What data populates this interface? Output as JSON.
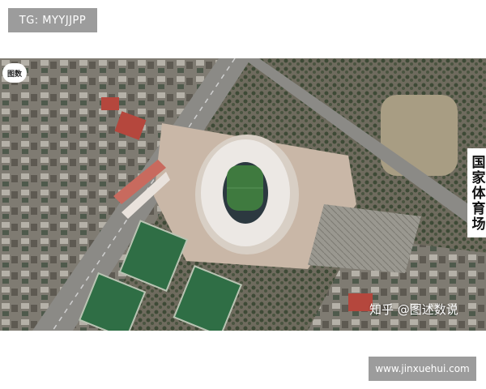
{
  "top_badge": "TG: MYYJJPP",
  "logo_text": "图数",
  "photo_label": "国家体育场",
  "watermark": "知乎 @图述数说",
  "bottom_badge": "www.jinxuehui.com",
  "colors": {
    "badge_bg": "#9c9c9c",
    "stadium_roof": "#ece8e4",
    "pitch": "#3f7a3f",
    "training_fields": "#2f6e45",
    "plaza": "#c9b7a7"
  }
}
